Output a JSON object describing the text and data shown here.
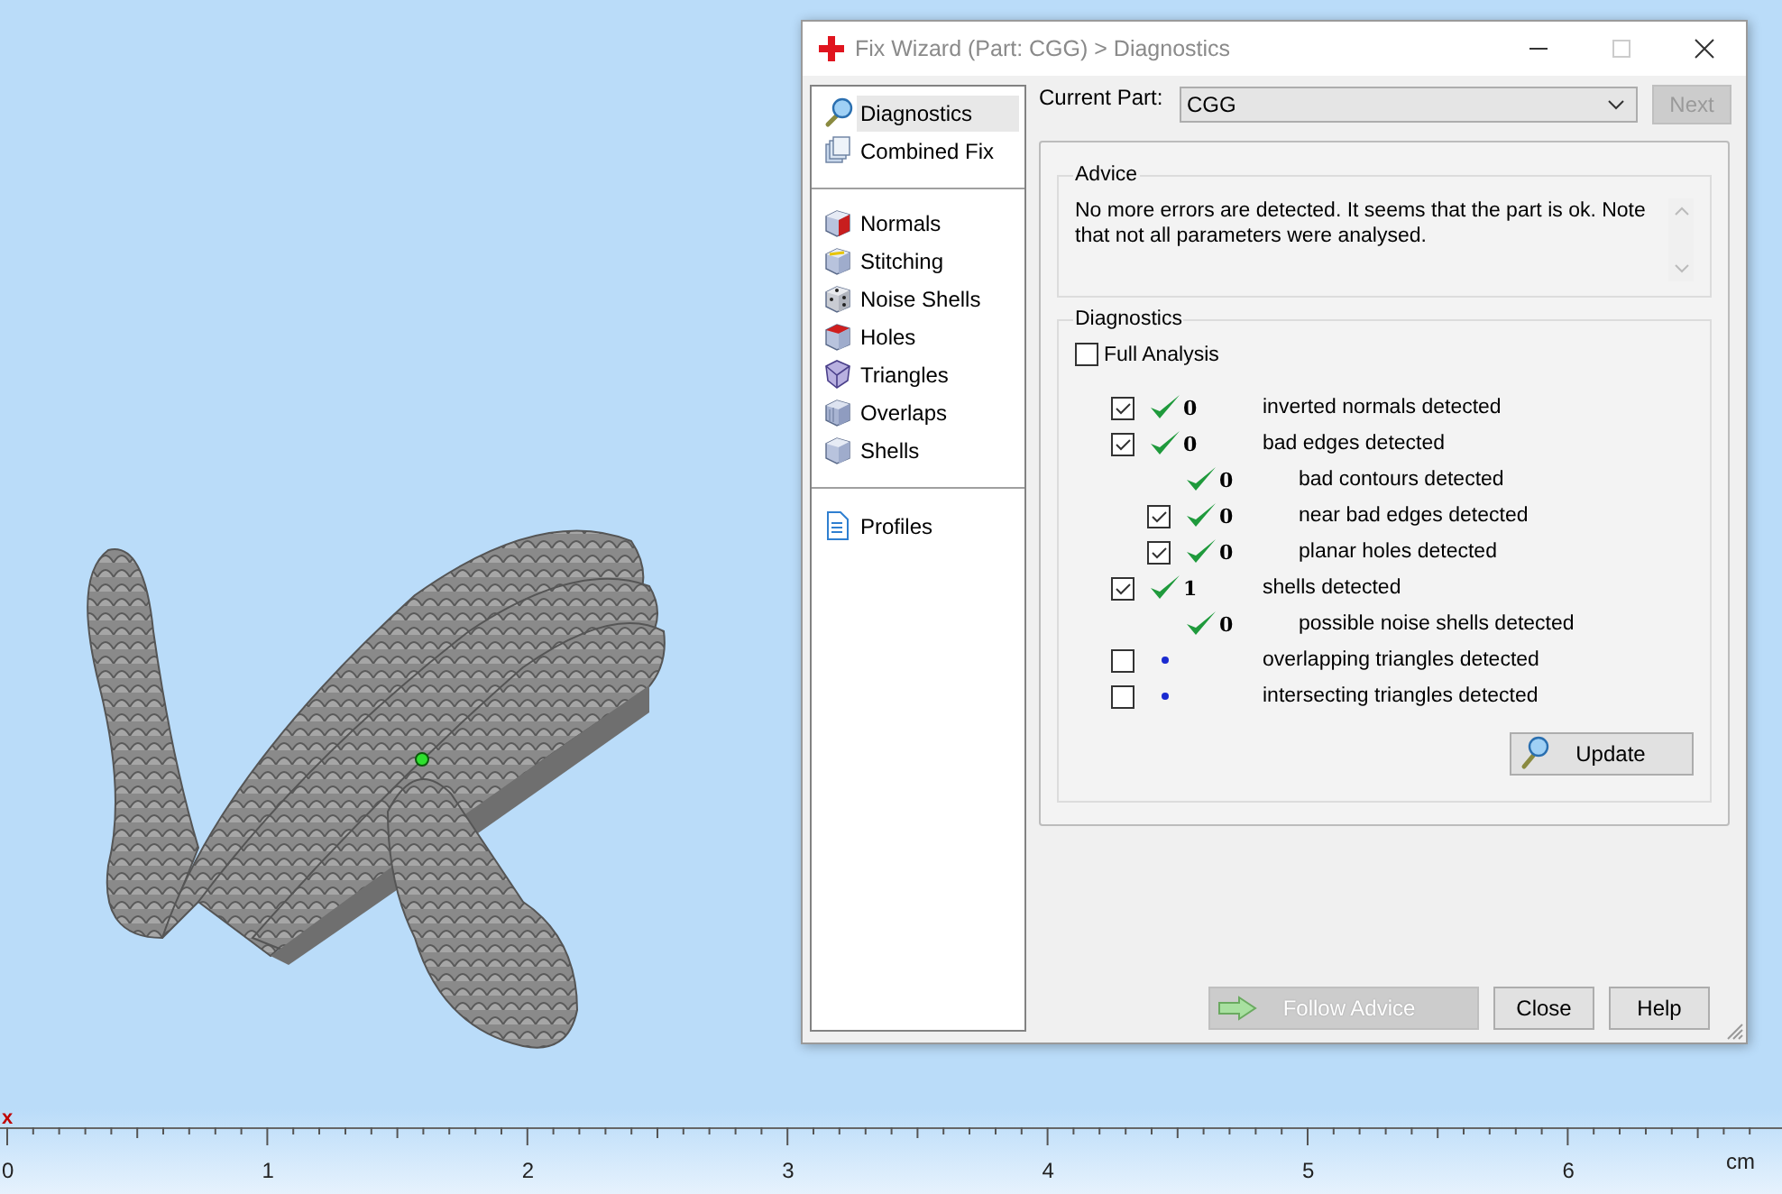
{
  "window": {
    "title": "Fix Wizard (Part: CGG) > Diagnostics",
    "maximize_disabled": true
  },
  "sidebar": {
    "groups": [
      [
        {
          "label": "Diagnostics",
          "kind": "magnifier",
          "selected": true
        },
        {
          "label": "Combined Fix",
          "kind": "sheets",
          "selected": false
        }
      ],
      [
        {
          "label": "Normals",
          "kind": "normals",
          "selected": false
        },
        {
          "label": "Stitching",
          "kind": "stitching",
          "selected": false
        },
        {
          "label": "Noise Shells",
          "kind": "dice",
          "selected": false
        },
        {
          "label": "Holes",
          "kind": "holes",
          "selected": false
        },
        {
          "label": "Triangles",
          "kind": "polyhedron",
          "selected": false
        },
        {
          "label": "Overlaps",
          "kind": "overlaps",
          "selected": false
        },
        {
          "label": "Shells",
          "kind": "cube",
          "selected": false
        }
      ],
      [
        {
          "label": "Profiles",
          "kind": "document",
          "selected": false
        }
      ]
    ]
  },
  "current_part": {
    "label": "Current Part:",
    "value": "CGG"
  },
  "next_button": {
    "label": "Next",
    "disabled": true
  },
  "advice": {
    "title": "Advice",
    "text": "No more errors are detected. It seems that the part is ok. Note that not all parameters were analysed."
  },
  "diagnostics": {
    "title": "Diagnostics",
    "full_analysis": {
      "label": "Full Analysis",
      "checked": false
    },
    "rows": [
      {
        "checked": true,
        "kind": "ok",
        "count": "0",
        "label": "inverted normals detected"
      },
      {
        "checked": true,
        "kind": "ok",
        "count": "0",
        "label": "bad edges detected",
        "children": [
          {
            "kind": "ok",
            "count": "0",
            "label": "bad contours detected"
          },
          {
            "checked": true,
            "kind": "ok",
            "count": "0",
            "label": "near bad edges detected"
          },
          {
            "checked": true,
            "kind": "ok",
            "count": "0",
            "label": "planar holes detected"
          }
        ]
      },
      {
        "checked": true,
        "kind": "ok",
        "count": "1",
        "label": "shells detected",
        "children": [
          {
            "kind": "ok",
            "count": "0",
            "label": "possible noise shells detected"
          }
        ]
      },
      {
        "checked": false,
        "kind": "pending",
        "label": "overlapping triangles detected"
      },
      {
        "checked": false,
        "kind": "pending",
        "label": "intersecting triangles detected"
      }
    ],
    "update_button": "Update"
  },
  "buttons": [
    {
      "label": "Follow Advice",
      "disabled": true,
      "kind": "arrow"
    },
    {
      "label": "Close",
      "disabled": false,
      "kind": "plain"
    },
    {
      "label": "Help",
      "disabled": false,
      "kind": "plain"
    }
  ],
  "ruler": {
    "marker": "x",
    "labels": [
      "0",
      "1",
      "2",
      "3",
      "4",
      "5",
      "6"
    ],
    "unit": "cm"
  }
}
